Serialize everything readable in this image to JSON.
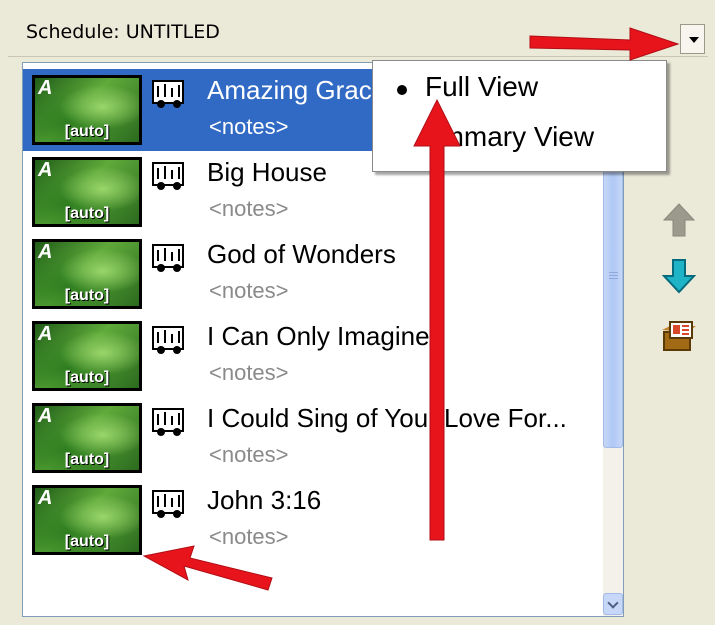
{
  "header": {
    "title": "Schedule: UNTITLED"
  },
  "items": [
    {
      "thumb_letter": "A",
      "thumb_label": "[auto]",
      "title": "Amazing Grac",
      "notes": "<notes>",
      "selected": true
    },
    {
      "thumb_letter": "A",
      "thumb_label": "[auto]",
      "title": "Big House",
      "notes": "<notes>"
    },
    {
      "thumb_letter": "A",
      "thumb_label": "[auto]",
      "title": "God of Wonders",
      "notes": "<notes>"
    },
    {
      "thumb_letter": "A",
      "thumb_label": "[auto]",
      "title": "I Can Only Imagine",
      "notes": "<notes>"
    },
    {
      "thumb_letter": "A",
      "thumb_label": "[auto]",
      "title": "I Could Sing of Your Love For...",
      "notes": "<notes>"
    },
    {
      "thumb_letter": "A",
      "thumb_label": "[auto]",
      "title": "John 3:16",
      "notes": "<notes>"
    }
  ],
  "view_menu": {
    "items": [
      {
        "label": "Full View",
        "checked": true
      },
      {
        "label": "ummary View",
        "checked": false
      }
    ]
  },
  "toolbar": {
    "icons": [
      "move-up-icon",
      "move-down-icon",
      "presentation-icon"
    ]
  },
  "colors": {
    "selection": "#316ac5",
    "annotation_arrow": "#e8141c",
    "move_down": "#1fb3c8"
  }
}
